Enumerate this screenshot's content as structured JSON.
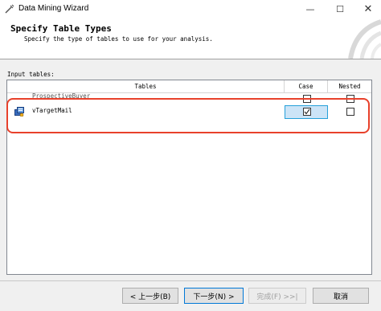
{
  "window": {
    "title": "Data Mining Wizard",
    "minimize_glyph": "—",
    "maximize_glyph": "☐",
    "close_glyph": "✕"
  },
  "header": {
    "title": "Specify Table Types",
    "subtitle": "Specify the type of tables to use for your analysis."
  },
  "grid": {
    "label": "Input tables:",
    "columns": [
      "Tables",
      "Case",
      "Nested"
    ],
    "rows": [
      {
        "name": "ProspectiveBuyer",
        "case": false,
        "nested": false
      },
      {
        "name": "vTargetMail",
        "case": true,
        "nested": false
      }
    ]
  },
  "buttons": {
    "back": "< 上一步(B)",
    "next": "下一步(N) >",
    "finish": "完成(F) >>|",
    "cancel": "取消"
  },
  "colors": {
    "highlight": "#e8412b",
    "selection_bg": "#cce4f7",
    "selection_border": "#26a0da"
  }
}
